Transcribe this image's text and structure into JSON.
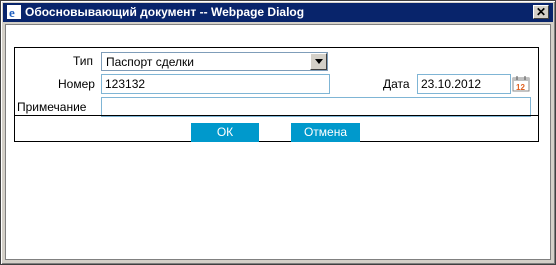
{
  "window": {
    "title": "Обосновывающий документ -- Webpage Dialog",
    "close_glyph": "✕"
  },
  "form": {
    "type_label": "Тип",
    "type_value": "Паспорт сделки",
    "number_label": "Номер",
    "number_value": "123132",
    "date_label": "Дата",
    "date_value": "23.10.2012",
    "note_label": "Примечание",
    "note_value": ""
  },
  "buttons": {
    "ok_label": "ОК",
    "cancel_label": "Отмена"
  },
  "icons": {
    "title_icon": "ie-icon",
    "calendar_icon": "calendar-icon",
    "calendar_day": "12",
    "dropdown_icon": "chevron-down-icon"
  },
  "colors": {
    "titlebar": "#08246b",
    "button": "#0099cc",
    "input_border": "#7fb5d5"
  }
}
